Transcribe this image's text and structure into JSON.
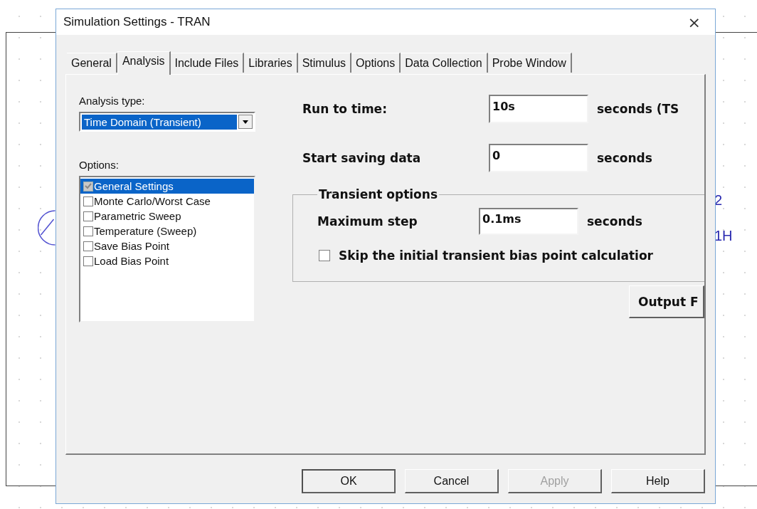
{
  "window": {
    "title": "Simulation Settings - TRAN",
    "close": "×"
  },
  "tabs": [
    {
      "label": "General",
      "selected": false
    },
    {
      "label": "Analysis",
      "selected": true
    },
    {
      "label": "Include Files",
      "selected": false
    },
    {
      "label": "Libraries",
      "selected": false
    },
    {
      "label": "Stimulus",
      "selected": false
    },
    {
      "label": "Options",
      "selected": false
    },
    {
      "label": "Data Collection",
      "selected": false
    },
    {
      "label": "Probe Window",
      "selected": false
    }
  ],
  "analysis_type": {
    "label": "Analysis type:",
    "value": "Time Domain (Transient)"
  },
  "options": {
    "label": "Options:",
    "items": [
      {
        "label": "General Settings",
        "checked": true,
        "disabled": true,
        "selected": true
      },
      {
        "label": "Monte Carlo/Worst Case",
        "checked": false,
        "disabled": false,
        "selected": false
      },
      {
        "label": "Parametric Sweep",
        "checked": false,
        "disabled": false,
        "selected": false
      },
      {
        "label": "Temperature (Sweep)",
        "checked": false,
        "disabled": false,
        "selected": false
      },
      {
        "label": "Save Bias Point",
        "checked": false,
        "disabled": false,
        "selected": false
      },
      {
        "label": "Load Bias Point",
        "checked": false,
        "disabled": false,
        "selected": false
      }
    ]
  },
  "run_to_time": {
    "label": "Run to time:",
    "value": "10s",
    "unit": "seconds  (TS"
  },
  "start_saving": {
    "label": "Start saving data",
    "value": "0",
    "unit": "seconds"
  },
  "transient_options": {
    "title": "Transient options",
    "max_step": {
      "label": "Maximum step",
      "value": "0.1ms",
      "unit": "seconds"
    },
    "skip": {
      "label": "Skip the initial transient bias point calculatior",
      "checked": false
    }
  },
  "output_button": {
    "label": "Output F"
  },
  "buttons": [
    {
      "label": "OK",
      "disabled": false,
      "default": true
    },
    {
      "label": "Cancel",
      "disabled": false,
      "default": false
    },
    {
      "label": "Apply",
      "disabled": true,
      "default": false
    },
    {
      "label": "Help",
      "disabled": false,
      "default": false
    }
  ],
  "canvas_labels": [
    "2",
    "1H"
  ]
}
